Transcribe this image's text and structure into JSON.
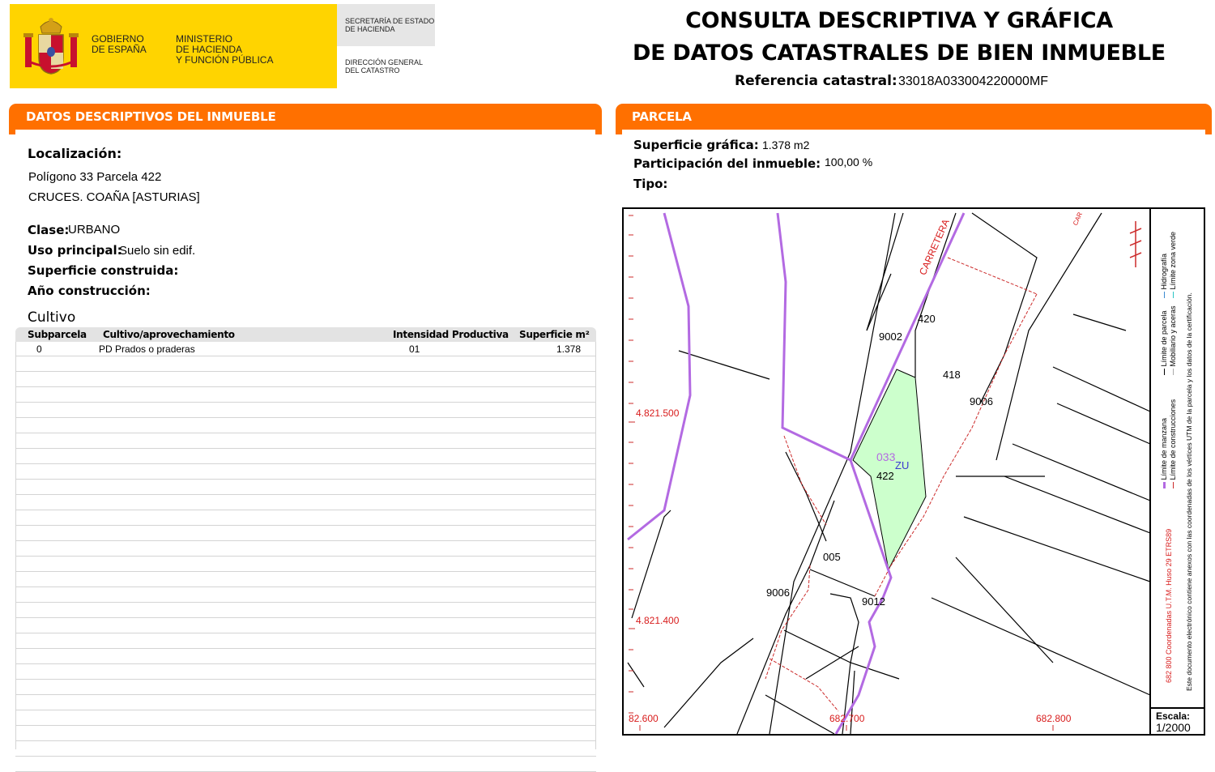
{
  "header": {
    "gobierno": "GOBIERNO\nDE ESPAÑA",
    "ministerio": "MINISTERIO\nDE HACIENDA\nY FUNCIÓN PÚBLICA",
    "secretaria": "SECRETARÍA DE ESTADO\nDE HACIENDA",
    "direccion": "DIRECCIÓN GENERAL\nDEL CATASTRO",
    "title": "CONSULTA DESCRIPTIVA Y GRÁFICA\nDE DATOS CATASTRALES DE BIEN INMUEBLE",
    "ref_label": "Referencia catastral:",
    "ref_value": "33018A033004220000MF"
  },
  "descriptivos": {
    "heading_normal": "DATOS DESCRIPTIVOS DEL ",
    "heading_bold": "INMUEBLE",
    "localizacion_label": "Localización:",
    "localizacion_line1": "Polígono 33 Parcela 422",
    "localizacion_line2": "CRUCES. COAÑA [ASTURIAS]",
    "clase_label": "Clase:",
    "clase_value": "URBANO",
    "uso_label": "Uso principal:",
    "uso_value": "Suelo sin edif.",
    "superficie_construida_label": "Superficie construida:",
    "anio_label": "Año construcción:",
    "cultivo_label": "Cultivo"
  },
  "cultivo_table": {
    "headers": [
      "Subparcela",
      "Cultivo/aprovechamiento",
      "Intensidad Productiva",
      "Superficie m²"
    ],
    "rows": [
      [
        "0",
        "PD Prados o praderas",
        "01",
        "1.378"
      ]
    ]
  },
  "parcela": {
    "heading": "PARCELA",
    "superficie_label": "Superficie gráfica:",
    "superficie_value": "1.378 m2",
    "participacion_label": "Participación del inmueble:",
    "participacion_value": "100,00 %",
    "tipo_label": "Tipo:"
  },
  "map": {
    "coord_y1": "4.821.500",
    "coord_y2": "4.821.400",
    "coord_x1": "82.600",
    "coord_x2": "682.700",
    "coord_x3": "682.800",
    "road_label": "CARRETERA",
    "road_label2": "CAR",
    "parcel_labels": [
      "9002",
      "420",
      "418",
      "9006",
      "422",
      "005",
      "9006",
      "9012"
    ],
    "poly_label": "033",
    "zone_label": "ZU",
    "scale_label": "Escala:",
    "scale_value": "1/2000",
    "legend": {
      "line1": "Límite de manzana",
      "line2": "Límite de construcciones",
      "line3": "Límite de parcela",
      "line4": "Mobiliario y aceras",
      "line5": "Hidrografía",
      "line6": "Límite zona verde",
      "coords_note": "682 800 Coordenadas U.T.M. Huso 29 ETRS89",
      "cert_note": "Este documento electrónico contiene anexos con las coordenadas de los vértices UTM de la parcela y los datos de la certificación."
    },
    "colors": {
      "manzana": "#b36ae2",
      "parcel_fill": "#ccffcc",
      "construccion": "#cc2b2b",
      "coords": "#d81c1c"
    }
  }
}
